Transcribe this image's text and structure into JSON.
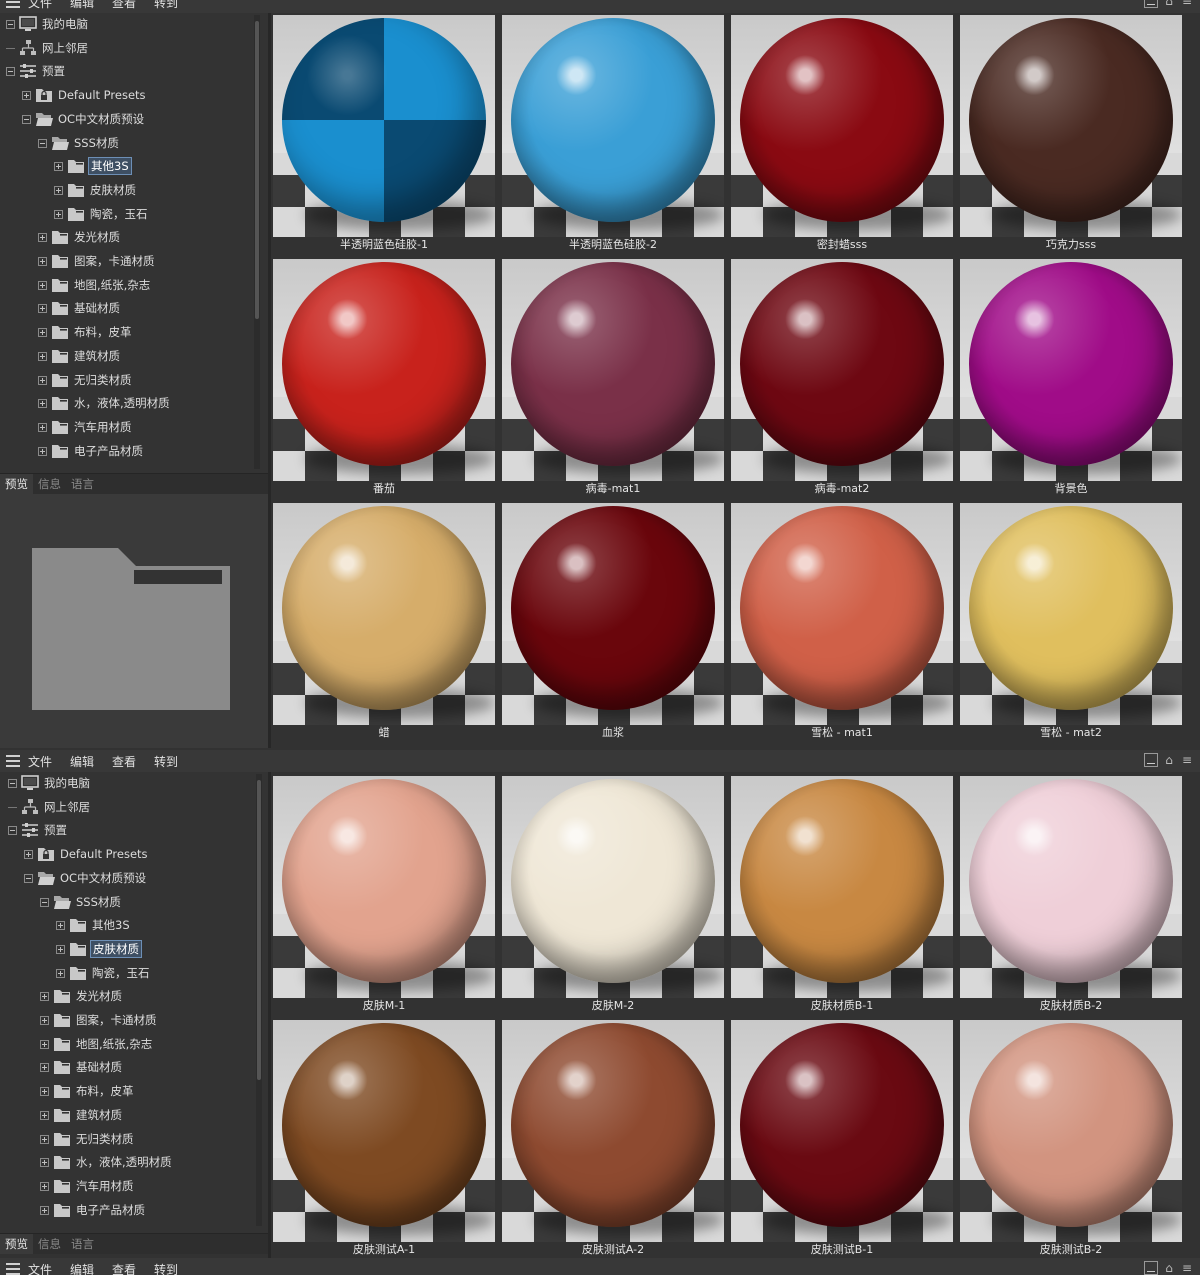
{
  "menu": {
    "items": [
      "文件",
      "编辑",
      "查看",
      "转到"
    ]
  },
  "tabs": [
    "预览",
    "信息",
    "语言"
  ],
  "top": {
    "tree": [
      {
        "label": "我的电脑",
        "level": 0,
        "icon": "computer",
        "expander": "open"
      },
      {
        "label": "网上邻居",
        "level": 0,
        "icon": "network",
        "expander": "none"
      },
      {
        "label": "预置",
        "level": 0,
        "icon": "presets",
        "expander": "open"
      },
      {
        "label": "Default Presets",
        "level": 1,
        "icon": "folder-locked",
        "expander": "closed"
      },
      {
        "label": "OC中文材质预设",
        "level": 1,
        "icon": "folder-open",
        "expander": "open"
      },
      {
        "label": "SSS材质",
        "level": 2,
        "icon": "folder-open",
        "expander": "open"
      },
      {
        "label": "其他3S",
        "level": 3,
        "icon": "folder",
        "expander": "closed",
        "selected": true
      },
      {
        "label": "皮肤材质",
        "level": 3,
        "icon": "folder",
        "expander": "closed"
      },
      {
        "label": "陶瓷，玉石",
        "level": 3,
        "icon": "folder",
        "expander": "closed"
      },
      {
        "label": "发光材质",
        "level": 2,
        "icon": "folder",
        "expander": "closed"
      },
      {
        "label": "图案，卡通材质",
        "level": 2,
        "icon": "folder",
        "expander": "closed"
      },
      {
        "label": "地图,纸张,杂志",
        "level": 2,
        "icon": "folder",
        "expander": "closed"
      },
      {
        "label": "基础材质",
        "level": 2,
        "icon": "folder",
        "expander": "closed"
      },
      {
        "label": "布料，皮革",
        "level": 2,
        "icon": "folder",
        "expander": "closed"
      },
      {
        "label": "建筑材质",
        "level": 2,
        "icon": "folder",
        "expander": "closed"
      },
      {
        "label": "无归类材质",
        "level": 2,
        "icon": "folder",
        "expander": "closed"
      },
      {
        "label": "水，液体,透明材质",
        "level": 2,
        "icon": "folder",
        "expander": "closed"
      },
      {
        "label": "汽车用材质",
        "level": 2,
        "icon": "folder",
        "expander": "closed"
      },
      {
        "label": "电子产品材质",
        "level": 2,
        "icon": "folder",
        "expander": "closed"
      }
    ],
    "materials": [
      {
        "label": "半透明蓝色硅胶-1",
        "color": "#1a8fcf",
        "checker": true
      },
      {
        "label": "半透明蓝色硅胶-2",
        "color": "#3a9fd6"
      },
      {
        "label": "密封蜡sss",
        "color": "#8a0a12"
      },
      {
        "label": "巧克力sss",
        "color": "#4a2a22"
      },
      {
        "label": "番茄",
        "color": "#c8221c"
      },
      {
        "label": "病毒-mat1",
        "color": "#7a3048"
      },
      {
        "label": "病毒-mat2",
        "color": "#6e0812"
      },
      {
        "label": "背景色",
        "color": "#a00c88"
      },
      {
        "label": "蜡",
        "color": "#d6ad6a"
      },
      {
        "label": "血浆",
        "color": "#6a060c"
      },
      {
        "label": "雪松 - mat1",
        "color": "#d06048"
      },
      {
        "label": "雪松 - mat2",
        "color": "#e0bf5e"
      }
    ]
  },
  "bottom": {
    "tree": [
      {
        "label": "我的电脑",
        "level": 0,
        "icon": "computer",
        "expander": "open"
      },
      {
        "label": "网上邻居",
        "level": 0,
        "icon": "network",
        "expander": "none"
      },
      {
        "label": "预置",
        "level": 0,
        "icon": "presets",
        "expander": "open"
      },
      {
        "label": "Default Presets",
        "level": 1,
        "icon": "folder-locked",
        "expander": "closed"
      },
      {
        "label": "OC中文材质预设",
        "level": 1,
        "icon": "folder-open",
        "expander": "open"
      },
      {
        "label": "SSS材质",
        "level": 2,
        "icon": "folder-open",
        "expander": "open"
      },
      {
        "label": "其他3S",
        "level": 3,
        "icon": "folder",
        "expander": "closed"
      },
      {
        "label": "皮肤材质",
        "level": 3,
        "icon": "folder",
        "expander": "closed",
        "selected": true
      },
      {
        "label": "陶瓷，玉石",
        "level": 3,
        "icon": "folder",
        "expander": "closed"
      },
      {
        "label": "发光材质",
        "level": 2,
        "icon": "folder",
        "expander": "closed"
      },
      {
        "label": "图案，卡通材质",
        "level": 2,
        "icon": "folder",
        "expander": "closed"
      },
      {
        "label": "地图,纸张,杂志",
        "level": 2,
        "icon": "folder",
        "expander": "closed"
      },
      {
        "label": "基础材质",
        "level": 2,
        "icon": "folder",
        "expander": "closed"
      },
      {
        "label": "布料，皮革",
        "level": 2,
        "icon": "folder",
        "expander": "closed"
      },
      {
        "label": "建筑材质",
        "level": 2,
        "icon": "folder",
        "expander": "closed"
      },
      {
        "label": "无归类材质",
        "level": 2,
        "icon": "folder",
        "expander": "closed"
      },
      {
        "label": "水，液体,透明材质",
        "level": 2,
        "icon": "folder",
        "expander": "closed"
      },
      {
        "label": "汽车用材质",
        "level": 2,
        "icon": "folder",
        "expander": "closed"
      },
      {
        "label": "电子产品材质",
        "level": 2,
        "icon": "folder",
        "expander": "closed"
      }
    ],
    "materials": [
      {
        "label": "皮肤M-1",
        "color": "#e2a38e"
      },
      {
        "label": "皮肤M-2",
        "color": "#efe7d6"
      },
      {
        "label": "皮肤材质B-1",
        "color": "#c88842"
      },
      {
        "label": "皮肤材质B-2",
        "color": "#efcfd8"
      },
      {
        "label": "皮肤测试A-1",
        "color": "#7e4a22"
      },
      {
        "label": "皮肤测试A-2",
        "color": "#8e4a30"
      },
      {
        "label": "皮肤测试B-1",
        "color": "#6a0a12"
      },
      {
        "label": "皮肤测试B-2",
        "color": "#d29480"
      }
    ]
  }
}
